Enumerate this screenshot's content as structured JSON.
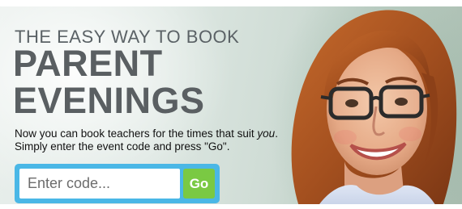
{
  "banner": {
    "eyebrow": "THE EASY WAY TO BOOK",
    "headline_line1": "PARENT",
    "headline_line2": "EVENINGS",
    "desc_line1_pre": "Now you can book teachers for the times that suit ",
    "desc_line1_em": "you",
    "desc_line1_post": ".",
    "desc_line2": "Simply enter the event code and press \"Go\"."
  },
  "form": {
    "code_placeholder": "Enter code...",
    "code_value": "",
    "go_label": "Go"
  },
  "colors": {
    "accent_blue": "#4ab7e6",
    "go_green": "#7ac943",
    "headline_gray": "#5a5f62"
  }
}
